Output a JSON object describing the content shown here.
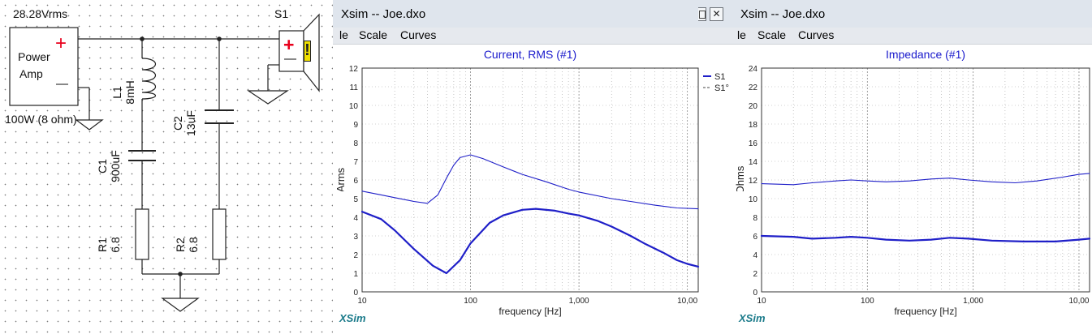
{
  "schematic": {
    "source_voltage": "28.28Vrms",
    "amp_label_line1": "Power",
    "amp_label_line2": "Amp",
    "amp_plus": "+",
    "amp_minus": "—",
    "amp_rating": "100W (8 ohm)",
    "speaker_name": "S1",
    "speaker_plus": "+",
    "speaker_minus": "—",
    "speaker_warning": "!",
    "components": [
      {
        "ref": "L1",
        "value": "8mH"
      },
      {
        "ref": "C2",
        "value": "13uF"
      },
      {
        "ref": "C1",
        "value": "900uF"
      },
      {
        "ref": "R1",
        "value": "6.8"
      },
      {
        "ref": "R2",
        "value": "6.8"
      }
    ]
  },
  "windows": [
    {
      "title": "Xsim -- Joe.dxo",
      "menu": [
        "le",
        "Scale",
        "Curves"
      ],
      "watermark": "XSim",
      "chart_title": "Current, RMS (#1)",
      "ylabel": "Arms",
      "xlabel": "frequency [Hz]"
    },
    {
      "title": "Xsim -- Joe.dxo",
      "menu": [
        "le",
        "Scale",
        "Curves"
      ],
      "watermark": "XSim",
      "chart_title": "Impedance (#1)",
      "ylabel": "Ohms",
      "xlabel": "frequency [Hz]"
    }
  ],
  "colors": {
    "curve": "#1f1fc8",
    "text_blue": "#1a1acc",
    "plus_red": "#e8001c",
    "warning_yellow": "#f0e000",
    "watermark": "#1a7a8a"
  },
  "chart_data": [
    {
      "type": "line",
      "title": "Current, RMS (#1)",
      "xlabel": "frequency [Hz]",
      "ylabel": "Arms",
      "xscale": "log",
      "xlim": [
        10,
        12589
      ],
      "ylim": [
        0,
        12
      ],
      "xticks": [
        "10",
        "100",
        "1,000",
        "10,00"
      ],
      "yticks": [
        "0",
        "1",
        "2",
        "3",
        "4",
        "5",
        "6",
        "7",
        "8",
        "9",
        "10",
        "11",
        "12"
      ],
      "legend": [
        {
          "name": "S1",
          "style": "solid"
        },
        {
          "name": "S1°",
          "style": "dashed"
        }
      ],
      "legend_position": "top-right",
      "grid": true,
      "series": [
        {
          "name": "S1",
          "points": [
            [
              10,
              4.3
            ],
            [
              15,
              3.9
            ],
            [
              20,
              3.3
            ],
            [
              30,
              2.3
            ],
            [
              45,
              1.4
            ],
            [
              60,
              1.0
            ],
            [
              80,
              1.7
            ],
            [
              100,
              2.6
            ],
            [
              150,
              3.7
            ],
            [
              200,
              4.1
            ],
            [
              300,
              4.4
            ],
            [
              400,
              4.45
            ],
            [
              600,
              4.35
            ],
            [
              800,
              4.2
            ],
            [
              1000,
              4.1
            ],
            [
              1500,
              3.8
            ],
            [
              2000,
              3.5
            ],
            [
              3000,
              3.0
            ],
            [
              4000,
              2.6
            ],
            [
              6000,
              2.1
            ],
            [
              8000,
              1.7
            ],
            [
              10000,
              1.5
            ],
            [
              12589,
              1.35
            ]
          ]
        },
        {
          "name": "",
          "points": [
            [
              10,
              5.4
            ],
            [
              15,
              5.2
            ],
            [
              20,
              5.05
            ],
            [
              30,
              4.85
            ],
            [
              40,
              4.75
            ],
            [
              50,
              5.2
            ],
            [
              60,
              6.1
            ],
            [
              70,
              6.8
            ],
            [
              80,
              7.2
            ],
            [
              100,
              7.35
            ],
            [
              130,
              7.15
            ],
            [
              200,
              6.7
            ],
            [
              300,
              6.3
            ],
            [
              500,
              5.9
            ],
            [
              800,
              5.5
            ],
            [
              1000,
              5.35
            ],
            [
              2000,
              5.0
            ],
            [
              3000,
              4.85
            ],
            [
              5000,
              4.65
            ],
            [
              8000,
              4.5
            ],
            [
              12589,
              4.45
            ]
          ]
        }
      ]
    },
    {
      "type": "line",
      "title": "Impedance (#1)",
      "xlabel": "frequency [Hz]",
      "ylabel": "Ohms",
      "xscale": "log",
      "xlim": [
        10,
        12589
      ],
      "ylim": [
        0,
        24
      ],
      "xticks": [
        "10",
        "100",
        "1,000",
        "10,00"
      ],
      "yticks": [
        "0",
        "2",
        "4",
        "6",
        "8",
        "10",
        "12",
        "14",
        "16",
        "18",
        "20",
        "22",
        "24"
      ],
      "grid": true,
      "series": [
        {
          "name": "",
          "points": [
            [
              10,
              6.0
            ],
            [
              20,
              5.9
            ],
            [
              30,
              5.7
            ],
            [
              50,
              5.8
            ],
            [
              70,
              5.9
            ],
            [
              100,
              5.8
            ],
            [
              150,
              5.6
            ],
            [
              250,
              5.5
            ],
            [
              400,
              5.6
            ],
            [
              600,
              5.8
            ],
            [
              900,
              5.7
            ],
            [
              1500,
              5.5
            ],
            [
              3000,
              5.4
            ],
            [
              6000,
              5.4
            ],
            [
              10000,
              5.6
            ],
            [
              12589,
              5.7
            ]
          ]
        },
        {
          "name": "",
          "points": [
            [
              10,
              11.6
            ],
            [
              20,
              11.5
            ],
            [
              30,
              11.7
            ],
            [
              50,
              11.9
            ],
            [
              70,
              12.0
            ],
            [
              100,
              11.9
            ],
            [
              150,
              11.8
            ],
            [
              250,
              11.9
            ],
            [
              400,
              12.1
            ],
            [
              600,
              12.2
            ],
            [
              900,
              12.0
            ],
            [
              1500,
              11.8
            ],
            [
              2500,
              11.7
            ],
            [
              4000,
              11.9
            ],
            [
              7000,
              12.3
            ],
            [
              10000,
              12.6
            ],
            [
              12589,
              12.7
            ]
          ]
        }
      ]
    }
  ]
}
